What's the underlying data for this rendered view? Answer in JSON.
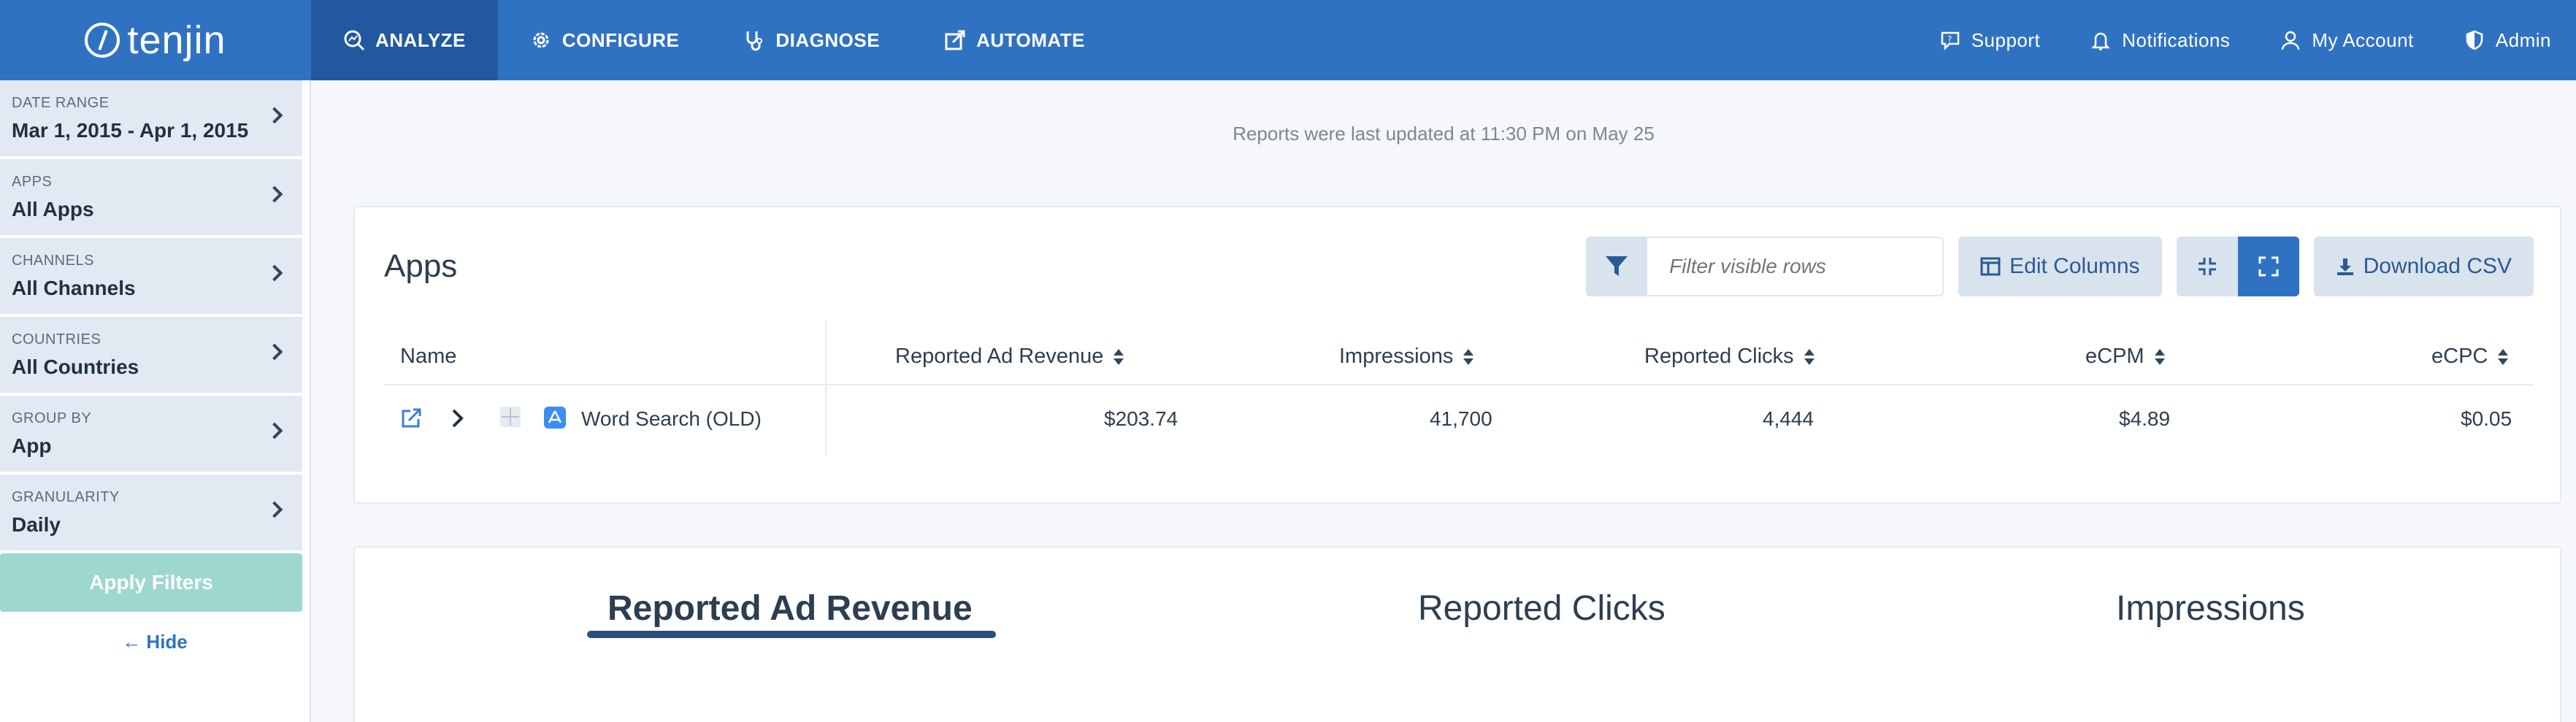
{
  "brand": {
    "name": "tenjin"
  },
  "nav": {
    "main": [
      {
        "label": "ANALYZE",
        "icon": "analyze-icon",
        "active": true
      },
      {
        "label": "CONFIGURE",
        "icon": "gear-icon",
        "active": false
      },
      {
        "label": "DIAGNOSE",
        "icon": "stethoscope-icon",
        "active": false
      },
      {
        "label": "AUTOMATE",
        "icon": "automate-icon",
        "active": false
      }
    ],
    "right": [
      {
        "label": "Support",
        "icon": "support-icon"
      },
      {
        "label": "Notifications",
        "icon": "bell-icon"
      },
      {
        "label": "My Account",
        "icon": "user-icon"
      },
      {
        "label": "Admin",
        "icon": "shield-icon"
      }
    ]
  },
  "sidebar": {
    "filters": [
      {
        "label": "DATE RANGE",
        "value": "Mar 1, 2015 - Apr 1, 2015"
      },
      {
        "label": "APPS",
        "value": "All Apps"
      },
      {
        "label": "CHANNELS",
        "value": "All Channels"
      },
      {
        "label": "COUNTRIES",
        "value": "All Countries"
      },
      {
        "label": "GROUP BY",
        "value": "App"
      },
      {
        "label": "GRANULARITY",
        "value": "Daily"
      }
    ],
    "apply_label": "Apply Filters",
    "hide_label": "← Hide"
  },
  "main": {
    "updated_text": "Reports were last updated at 11:30 PM on May 25",
    "apps_card": {
      "title": "Apps",
      "filter_placeholder": "Filter visible rows",
      "edit_columns_label": "Edit Columns",
      "download_label": "Download CSV",
      "columns": [
        "Name",
        "Reported Ad Revenue",
        "Impressions",
        "Reported Clicks",
        "eCPM",
        "eCPC"
      ],
      "rows": [
        {
          "name": "Word Search (OLD)",
          "revenue": "$203.74",
          "impressions": "41,700",
          "clicks": "4,444",
          "ecpm": "$4.89",
          "ecpc": "$0.05"
        }
      ]
    },
    "chart_tabs": [
      {
        "label": "Reported Ad Revenue",
        "active": true
      },
      {
        "label": "Reported Clicks",
        "active": false
      },
      {
        "label": "Impressions",
        "active": false
      }
    ]
  },
  "colors": {
    "primary": "#3072c2",
    "nav_active": "#2158a0",
    "apply": "#9ed7cf",
    "sidebar_filter": "#e2e9f2"
  }
}
